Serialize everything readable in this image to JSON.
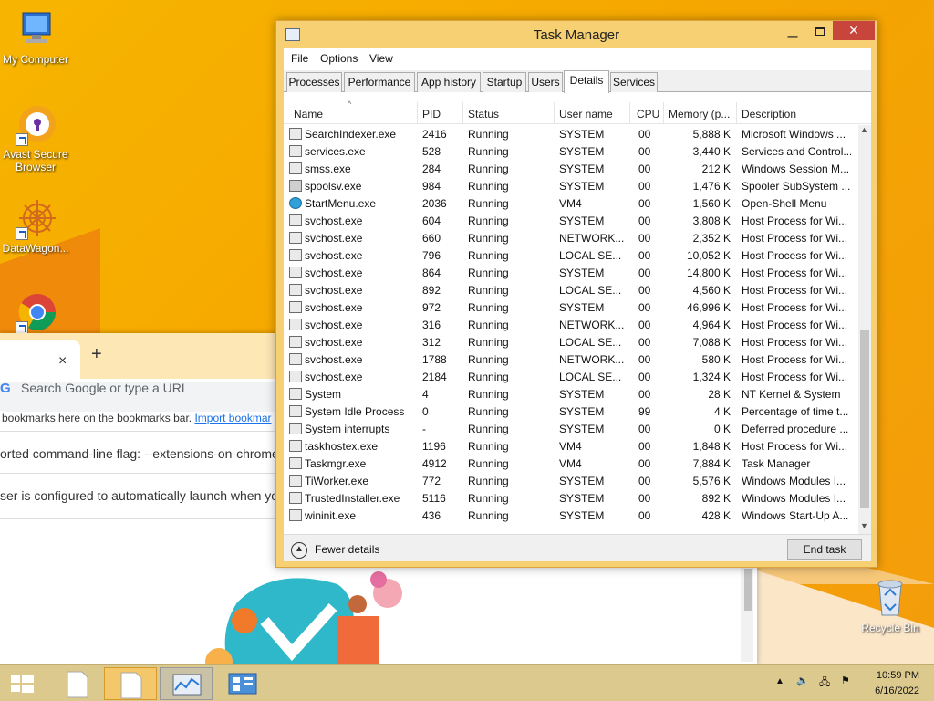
{
  "desktop": {
    "icons": [
      {
        "label": "My Computer",
        "icon": "computer-icon"
      },
      {
        "label": "Avast Secure Browser",
        "icon": "avast-icon"
      },
      {
        "label": "DataWagon...",
        "icon": "datawagon-icon"
      },
      {
        "label": "",
        "icon": "chrome-icon"
      }
    ],
    "recycle_bin": "Recycle Bin"
  },
  "browser": {
    "search_placeholder": "Search Google or type a URL",
    "new_tab": "+",
    "close_tab": "×",
    "bookmarks_text": " bookmarks here on the bookmarks bar. ",
    "bookmarks_link": "Import bookmar",
    "info1": "orted command-line flag: --extensions-on-chrome-ur",
    "info2": "ser is configured to automatically launch when you st"
  },
  "task_manager": {
    "title": "Task Manager",
    "menu": [
      "File",
      "Options",
      "View"
    ],
    "tabs": [
      "Processes",
      "Performance",
      "App history",
      "Startup",
      "Users",
      "Details",
      "Services"
    ],
    "active_tab": "Details",
    "columns": [
      "Name",
      "PID",
      "Status",
      "User name",
      "CPU",
      "Memory (p...",
      "Description"
    ],
    "rows": [
      {
        "name": "SearchIndexer.exe",
        "pid": "2416",
        "status": "Running",
        "user": "SYSTEM",
        "cpu": "00",
        "mem": "5,888 K",
        "desc": "Microsoft Windows ...",
        "icon": "search-indexer-icon"
      },
      {
        "name": "services.exe",
        "pid": "528",
        "status": "Running",
        "user": "SYSTEM",
        "cpu": "00",
        "mem": "3,440 K",
        "desc": "Services and Control...",
        "icon": "process-icon"
      },
      {
        "name": "smss.exe",
        "pid": "284",
        "status": "Running",
        "user": "SYSTEM",
        "cpu": "00",
        "mem": "212 K",
        "desc": "Windows Session M...",
        "icon": "process-icon"
      },
      {
        "name": "spoolsv.exe",
        "pid": "984",
        "status": "Running",
        "user": "SYSTEM",
        "cpu": "00",
        "mem": "1,476 K",
        "desc": "Spooler SubSystem ...",
        "icon": "printer-icon"
      },
      {
        "name": "StartMenu.exe",
        "pid": "2036",
        "status": "Running",
        "user": "VM4",
        "cpu": "00",
        "mem": "1,560 K",
        "desc": "Open-Shell Menu",
        "icon": "shell-icon"
      },
      {
        "name": "svchost.exe",
        "pid": "604",
        "status": "Running",
        "user": "SYSTEM",
        "cpu": "00",
        "mem": "3,808 K",
        "desc": "Host Process for Wi...",
        "icon": "process-icon"
      },
      {
        "name": "svchost.exe",
        "pid": "660",
        "status": "Running",
        "user": "NETWORK...",
        "cpu": "00",
        "mem": "2,352 K",
        "desc": "Host Process for Wi...",
        "icon": "process-icon"
      },
      {
        "name": "svchost.exe",
        "pid": "796",
        "status": "Running",
        "user": "LOCAL SE...",
        "cpu": "00",
        "mem": "10,052 K",
        "desc": "Host Process for Wi...",
        "icon": "process-icon"
      },
      {
        "name": "svchost.exe",
        "pid": "864",
        "status": "Running",
        "user": "SYSTEM",
        "cpu": "00",
        "mem": "14,800 K",
        "desc": "Host Process for Wi...",
        "icon": "process-icon"
      },
      {
        "name": "svchost.exe",
        "pid": "892",
        "status": "Running",
        "user": "LOCAL SE...",
        "cpu": "00",
        "mem": "4,560 K",
        "desc": "Host Process for Wi...",
        "icon": "process-icon"
      },
      {
        "name": "svchost.exe",
        "pid": "972",
        "status": "Running",
        "user": "SYSTEM",
        "cpu": "00",
        "mem": "46,996 K",
        "desc": "Host Process for Wi...",
        "icon": "process-icon"
      },
      {
        "name": "svchost.exe",
        "pid": "316",
        "status": "Running",
        "user": "NETWORK...",
        "cpu": "00",
        "mem": "4,964 K",
        "desc": "Host Process for Wi...",
        "icon": "process-icon"
      },
      {
        "name": "svchost.exe",
        "pid": "312",
        "status": "Running",
        "user": "LOCAL SE...",
        "cpu": "00",
        "mem": "7,088 K",
        "desc": "Host Process for Wi...",
        "icon": "process-icon"
      },
      {
        "name": "svchost.exe",
        "pid": "1788",
        "status": "Running",
        "user": "NETWORK...",
        "cpu": "00",
        "mem": "580 K",
        "desc": "Host Process for Wi...",
        "icon": "process-icon"
      },
      {
        "name": "svchost.exe",
        "pid": "2184",
        "status": "Running",
        "user": "LOCAL SE...",
        "cpu": "00",
        "mem": "1,324 K",
        "desc": "Host Process for Wi...",
        "icon": "process-icon"
      },
      {
        "name": "System",
        "pid": "4",
        "status": "Running",
        "user": "SYSTEM",
        "cpu": "00",
        "mem": "28 K",
        "desc": "NT Kernel & System",
        "icon": "process-icon"
      },
      {
        "name": "System Idle Process",
        "pid": "0",
        "status": "Running",
        "user": "SYSTEM",
        "cpu": "99",
        "mem": "4 K",
        "desc": "Percentage of time t...",
        "icon": "process-icon"
      },
      {
        "name": "System interrupts",
        "pid": "-",
        "status": "Running",
        "user": "SYSTEM",
        "cpu": "00",
        "mem": "0 K",
        "desc": "Deferred procedure ...",
        "icon": "process-icon"
      },
      {
        "name": "taskhostex.exe",
        "pid": "1196",
        "status": "Running",
        "user": "VM4",
        "cpu": "00",
        "mem": "1,848 K",
        "desc": "Host Process for Wi...",
        "icon": "process-icon"
      },
      {
        "name": "Taskmgr.exe",
        "pid": "4912",
        "status": "Running",
        "user": "VM4",
        "cpu": "00",
        "mem": "7,884 K",
        "desc": "Task Manager",
        "icon": "taskmgr-icon"
      },
      {
        "name": "TiWorker.exe",
        "pid": "772",
        "status": "Running",
        "user": "SYSTEM",
        "cpu": "00",
        "mem": "5,576 K",
        "desc": "Windows Modules I...",
        "icon": "process-icon"
      },
      {
        "name": "TrustedInstaller.exe",
        "pid": "5116",
        "status": "Running",
        "user": "SYSTEM",
        "cpu": "00",
        "mem": "892 K",
        "desc": "Windows Modules I...",
        "icon": "process-icon"
      },
      {
        "name": "wininit.exe",
        "pid": "436",
        "status": "Running",
        "user": "SYSTEM",
        "cpu": "00",
        "mem": "428 K",
        "desc": "Windows Start-Up A...",
        "icon": "process-icon"
      }
    ],
    "fewer_details": "Fewer details",
    "end_task": "End task"
  },
  "taskbar": {
    "time": "10:59 PM",
    "date": "6/16/2022"
  }
}
